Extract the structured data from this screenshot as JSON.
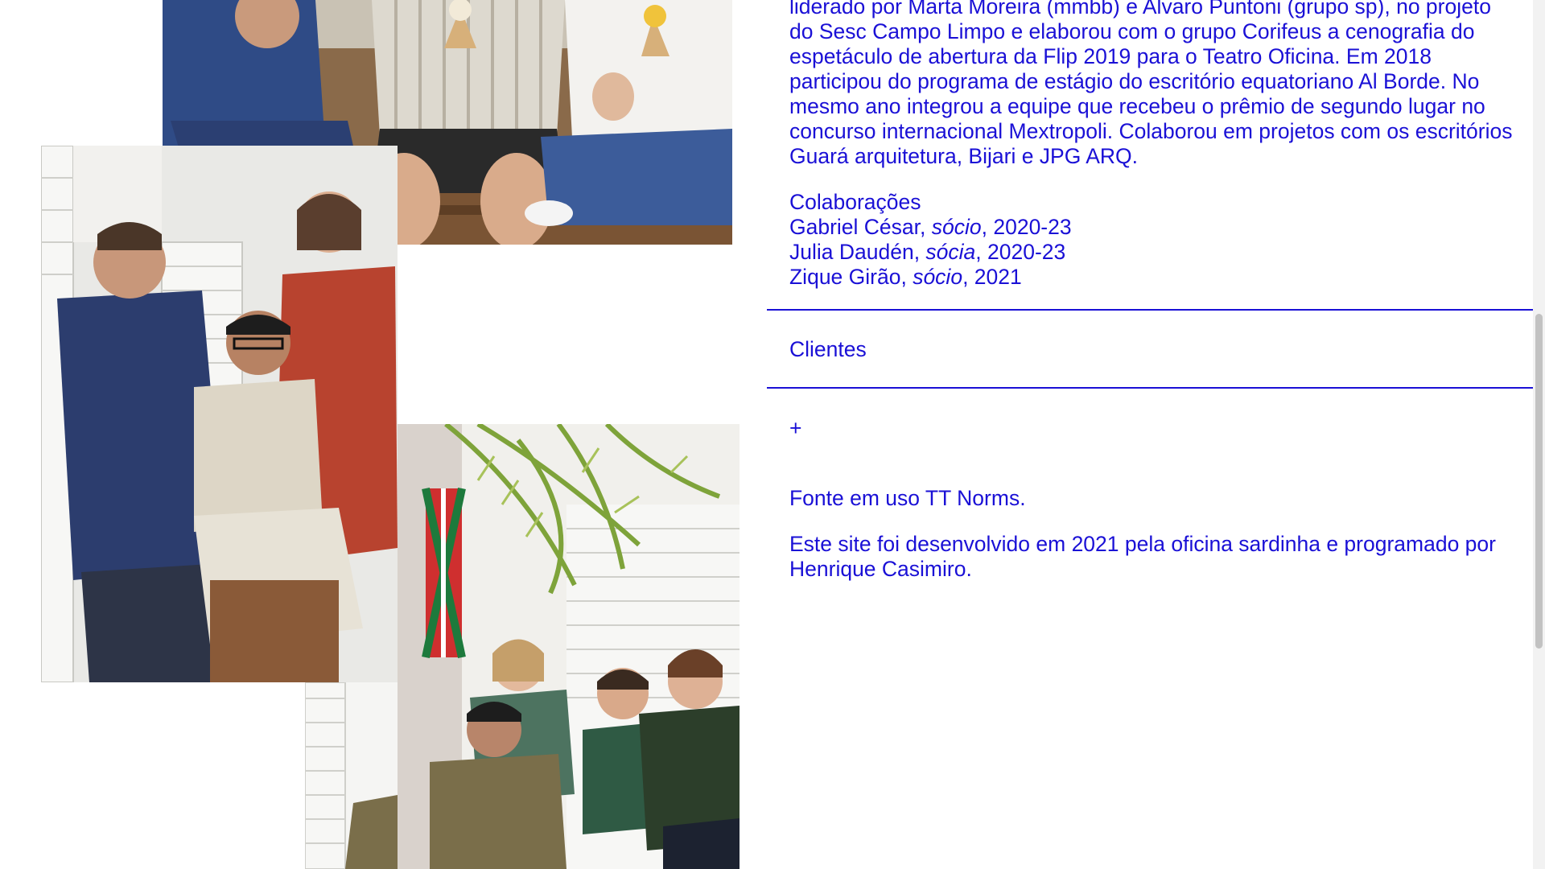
{
  "about": {
    "bio_text": "liderado por Marta Moreira (mmbb) e Alvaro Puntoni (grupo sp), no projeto do Sesc Campo Limpo e elaborou com o grupo Corifeus a cenografia do espetáculo de abertura da Flip 2019 para o Teatro Oficina. Em 2018 participou do programa de estágio do escritório equatoriano Al Borde. No mesmo ano integrou a equipe que recebeu o prêmio de segundo lugar no concurso internacional Mextropoli. Colaborou em projetos com os escritórios Guará arquitetura, Bijari e JPG ARQ.",
    "collab_heading": "Colaborações",
    "collaborators": [
      {
        "name": "Gabriel César, ",
        "role": "sócio",
        "years": ", 2020-23"
      },
      {
        "name": "Julia Daudén, ",
        "role": "sócia",
        "years": ", 2020-23"
      },
      {
        "name": "Zique Girão, ",
        "role": "sócio",
        "years": ", 2021"
      }
    ]
  },
  "clients": {
    "label": "Clientes",
    "expand_symbol": "+"
  },
  "footer": {
    "font_note": "Fonte em uso TT Norms.",
    "credits": "Este site foi desenvolvido em 2021 pela oficina sardinha e programado por Henrique Casimiro."
  },
  "colors": {
    "accent": "#1a10d6",
    "background": "#ffffff"
  }
}
